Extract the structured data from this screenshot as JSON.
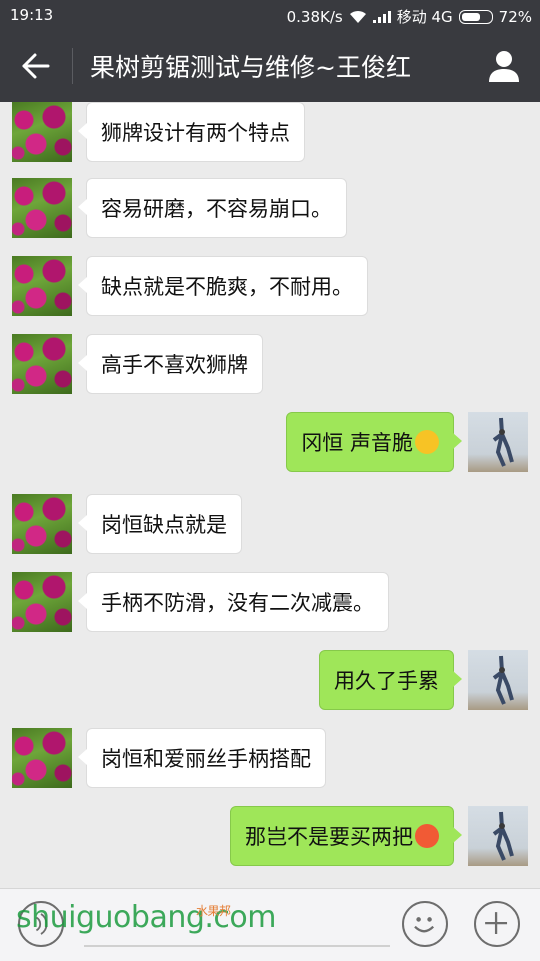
{
  "status_bar": {
    "time": "19:13",
    "network_speed": "0.38K/s",
    "carrier": "移动 4G",
    "battery": "72%",
    "battery_level": 0.72
  },
  "header": {
    "title": "果树剪锯测试与维修~王俊红",
    "back_icon": "back-arrow-icon",
    "profile_icon": "person-icon"
  },
  "messages": [
    {
      "side": "left",
      "text": "狮牌设计有两个特点"
    },
    {
      "side": "left",
      "text": "容易研磨，不容易崩口。"
    },
    {
      "side": "left",
      "text": "缺点就是不脆爽，不耐用。"
    },
    {
      "side": "left",
      "text": "高手不喜欢狮牌"
    },
    {
      "side": "right",
      "text": "冈恒 声音脆",
      "emoji": "grin-emoji"
    },
    {
      "side": "left",
      "text": "岗恒缺点就是"
    },
    {
      "side": "left",
      "text": "手柄不防滑，没有二次减震。"
    },
    {
      "side": "right",
      "text": "用久了手累"
    },
    {
      "side": "left",
      "text": "岗恒和爱丽丝手柄搭配"
    },
    {
      "side": "right",
      "text": "那岂不是要买两把",
      "emoji": "blush-emoji"
    }
  ],
  "input_bar": {
    "voice_icon": "voice-icon",
    "emoji_icon": "smiley-icon",
    "plus_icon": "plus-icon"
  },
  "watermark": {
    "text": "shuiguobang.com",
    "tagline": "水果邦"
  },
  "colors": {
    "header_bg": "#393a3f",
    "chat_bg": "#ebebeb",
    "sent_bubble": "#9fe659",
    "received_bubble": "#ffffff"
  }
}
